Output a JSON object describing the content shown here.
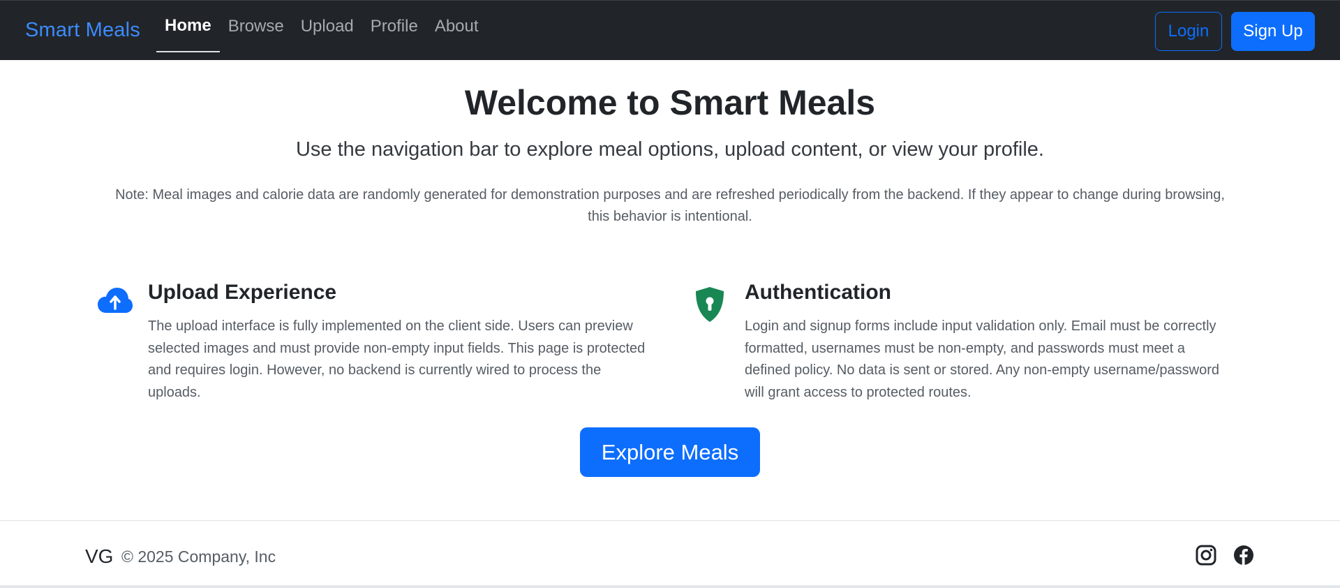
{
  "navbar": {
    "brand": "Smart Meals",
    "links": [
      {
        "label": "Home",
        "active": true
      },
      {
        "label": "Browse"
      },
      {
        "label": "Upload"
      },
      {
        "label": "Profile"
      },
      {
        "label": "About"
      }
    ],
    "login_label": "Login",
    "signup_label": "Sign Up"
  },
  "hero": {
    "title": "Welcome to Smart Meals",
    "lead": "Use the navigation bar to explore meal options, upload content, or view your profile.",
    "note": "Note: Meal images and calorie data are randomly generated for demonstration purposes and are refreshed periodically from the backend. If they appear to change during browsing, this behavior is intentional."
  },
  "features": [
    {
      "icon": "cloud-upload-icon",
      "title": "Upload Experience",
      "text": "The upload interface is fully implemented on the client side. Users can preview selected images and must provide non-empty input fields. This page is protected and requires login. However, no backend is currently wired to process the uploads."
    },
    {
      "icon": "shield-lock-icon",
      "title": "Authentication",
      "text": "Login and signup forms include input validation only. Email must be correctly formatted, usernames must be non-empty, and passwords must meet a defined policy. No data is sent or stored. Any non-empty username/password will grant access to protected routes."
    }
  ],
  "cta": {
    "label": "Explore Meals"
  },
  "footer": {
    "logo": "VG",
    "copyright": "© 2025 Company, Inc",
    "social": [
      "instagram-icon",
      "facebook-icon"
    ]
  },
  "colors": {
    "navbar_bg": "#212529",
    "primary": "#0d6efd",
    "brand": "#3d8bfd",
    "auth_icon": "#198754"
  }
}
